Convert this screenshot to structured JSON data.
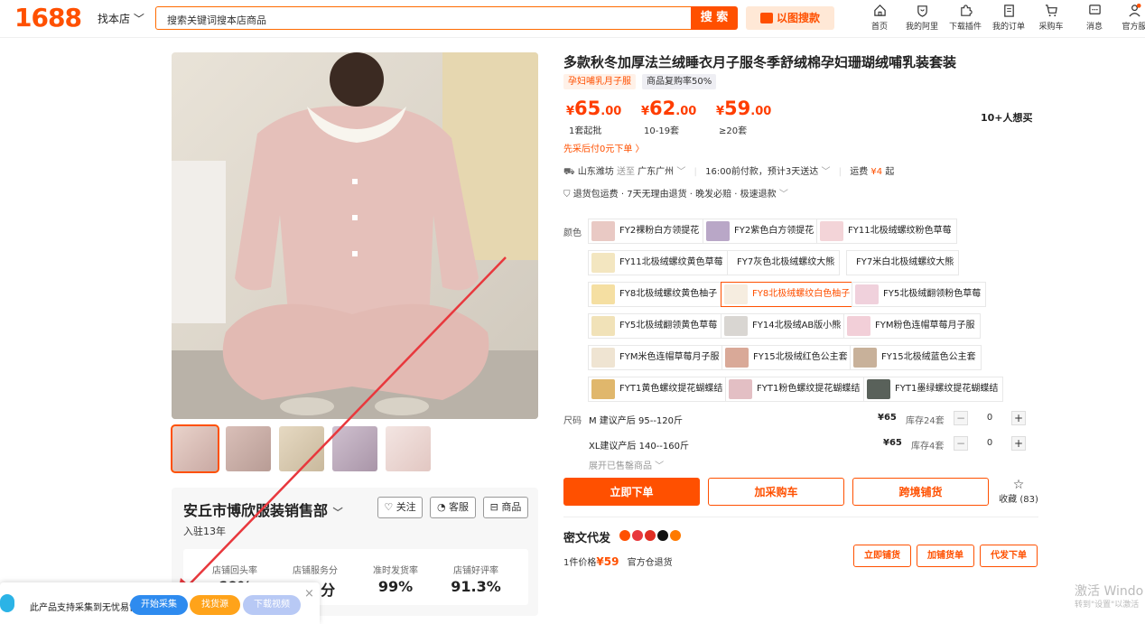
{
  "header": {
    "logo": "1688",
    "find_shop": "找本店",
    "search_placeholder": "搜索关键词搜本店商品",
    "search_button": "搜 索",
    "image_search": "以图搜款",
    "nav": [
      {
        "label": "首页",
        "icon": "home-icon"
      },
      {
        "label": "我的阿里",
        "icon": "heart-shield-icon"
      },
      {
        "label": "下载插件",
        "icon": "puzzle-icon"
      },
      {
        "label": "我的订单",
        "icon": "clipboard-icon"
      },
      {
        "label": "采购车",
        "icon": "cart-icon"
      },
      {
        "label": "消息",
        "icon": "message-icon"
      },
      {
        "label": "官方服",
        "icon": "user-icon"
      }
    ]
  },
  "product": {
    "title": "多款秋冬加厚法兰绒睡衣月子服冬季舒绒棉孕妇珊瑚绒哺乳装套装",
    "tags": [
      "孕妇哺乳月子服",
      "商品复购率50%"
    ],
    "prices": [
      {
        "value": "65",
        "decimal": ".00",
        "label": "1套起批"
      },
      {
        "value": "62",
        "decimal": ".00",
        "label": "10-19套"
      },
      {
        "value": "59",
        "decimal": ".00",
        "label": "≥20套"
      }
    ],
    "currency": "¥",
    "want": "10+人想买",
    "pay_later": "先采后付0元下单 〉",
    "shipping": {
      "from": "山东潍坊",
      "to_label": "送至",
      "to": "广东广州",
      "time": "16:00前付款，预计3天送达",
      "fee_label": "运费",
      "fee": "¥4",
      "fee_suffix": "起"
    },
    "services": "退货包运费 · 7天无理由退货 · 晚发必赔 · 极速退款"
  },
  "color_label": "颜色",
  "colors": [
    {
      "name": "FY2裸粉白方领提花",
      "swatch": "#e9c9c4"
    },
    {
      "name": "FY2紫色白方领提花",
      "swatch": "#b9a7c7"
    },
    {
      "name": "FY11北极绒螺纹粉色草莓",
      "swatch": "#f3d4d8"
    },
    {
      "name": "FY11北极绒螺纹黄色草莓",
      "swatch": "#f3e6c0"
    },
    {
      "name": "FY7灰色北极绒螺纹大熊",
      "swatch": ""
    },
    {
      "name": "FY7米白北极绒螺纹大熊",
      "swatch": ""
    },
    {
      "name": "FY8北极绒螺纹黄色柚子",
      "swatch": "#f5dfa2"
    },
    {
      "name": "FY8北极绒螺纹白色柚子",
      "swatch": "#f6ede0"
    },
    {
      "name": "FY5北极绒翻领粉色草莓",
      "swatch": "#f0d1dc"
    },
    {
      "name": "FY5北极绒翻领黄色草莓",
      "swatch": "#f1e2b8"
    },
    {
      "name": "FY14北极绒AB版小熊",
      "swatch": "#d9d6d2"
    },
    {
      "name": "FYM粉色连帽草莓月子服",
      "swatch": "#f2cfd8"
    },
    {
      "name": "FYM米色连帽草莓月子服",
      "swatch": "#efe4d2"
    },
    {
      "name": "FY15北极绒红色公主套",
      "swatch": "#d9a998"
    },
    {
      "name": "FY15北极绒蓝色公主套",
      "swatch": "#c8b19a"
    },
    {
      "name": "FYT1黄色螺纹提花蝴蝶结",
      "swatch": "#e0b76c"
    },
    {
      "name": "FYT1粉色螺纹提花蝴蝶结",
      "swatch": "#e3bfc4"
    },
    {
      "name": "FYT1墨绿螺纹提花蝴蝶结",
      "swatch": "#59615a"
    }
  ],
  "size_label": "尺码",
  "sizes": [
    {
      "name": "M 建议产后 95--120斤",
      "price": "¥65",
      "stock": "库存24套",
      "qty": "0"
    },
    {
      "name": "XL建议产后 140--160斤",
      "price": "¥65",
      "stock": "库存4套",
      "qty": "0"
    }
  ],
  "expand_sold_out": "展开已售罄商品 ﹀",
  "actions": {
    "buy_now": "立即下单",
    "add_cart": "加采购车",
    "cross_border": "跨境铺货",
    "favorite": "收藏 (83)"
  },
  "mw": {
    "title": "密文代发",
    "price_prefix": "1件价格",
    "price": "¥59",
    "warehouse": "官方仓退货",
    "btn_list": "立即铺货",
    "btn_add_list": "加铺货单",
    "btn_agent": "代发下单"
  },
  "shop": {
    "name": "安丘市博欣服装销售部",
    "years": "入驻13年",
    "follow": "关注",
    "service": "客服",
    "goods": "商品",
    "stats": [
      {
        "label": "店铺回头率",
        "value": "60%"
      },
      {
        "label": "店铺服务分",
        "value": "3.5分"
      },
      {
        "label": "准时发货率",
        "value": "99%"
      },
      {
        "label": "店铺好评率",
        "value": "91.3%"
      }
    ]
  },
  "plugin": {
    "text": "此产品支持采集到无忧易售",
    "start": "开始采集",
    "find": "找货源",
    "download": "下载视频",
    "close": "×"
  },
  "watermark": {
    "line1": "激活 Windo",
    "line2": "转到\"设置\"以激活"
  },
  "colors_theme": {
    "accent": "#ff5000",
    "price": "#ff3d00",
    "plugin_blue": "#2e8bef",
    "plugin_orange": "#ffa31a",
    "plugin_lilac": "#b8c9f5",
    "arrow": "#e8383d"
  }
}
